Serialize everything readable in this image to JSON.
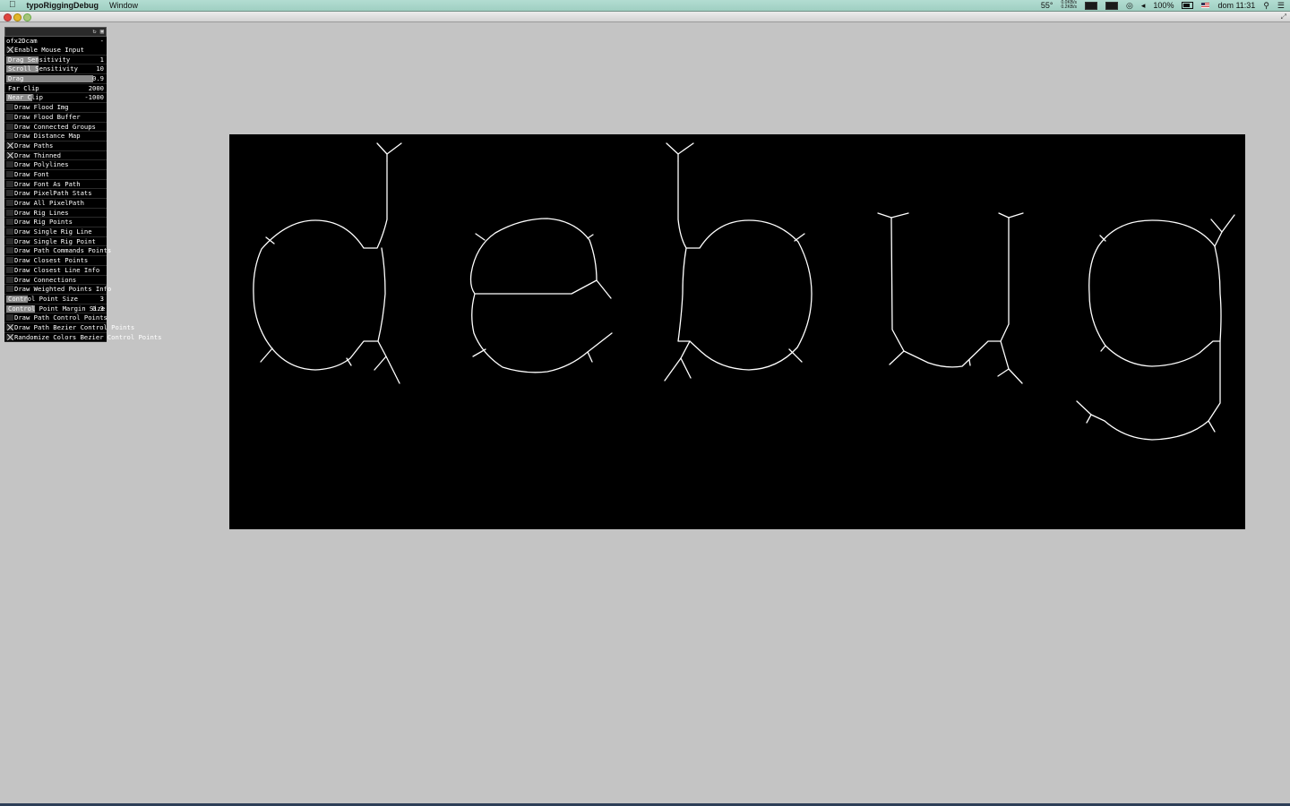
{
  "menubar": {
    "app_name": "typoRiggingDebug",
    "menu_window": "Window",
    "temp": "55°",
    "net_up": "0.0KB/s",
    "net_down": "0.2KB/s",
    "battery": "100%",
    "clock": "dom 11:31"
  },
  "gui": {
    "group_title": "ofx2Dcam",
    "collapse_symbol": "-",
    "rows": [
      {
        "kind": "toggle",
        "label": "Enable Mouse Input",
        "checked": true
      },
      {
        "kind": "slider",
        "label": "Drag Sensitivity",
        "value": "1",
        "fill": 0.33
      },
      {
        "kind": "slider",
        "label": "Scroll Sensitivity",
        "value": "10",
        "fill": 0.33
      },
      {
        "kind": "slider",
        "label": "Drag",
        "value": "0.9",
        "fill": 0.9
      },
      {
        "kind": "slider",
        "label": "Far Clip",
        "value": "2000",
        "fill": 0.0
      },
      {
        "kind": "slider",
        "label": "Near Clip",
        "value": "-1000",
        "fill": 0.27
      },
      {
        "kind": "toggle",
        "label": "Draw Flood Img",
        "checked": false
      },
      {
        "kind": "toggle",
        "label": "Draw Flood Buffer",
        "checked": false
      },
      {
        "kind": "toggle",
        "label": "Draw Connected Groups",
        "checked": false
      },
      {
        "kind": "toggle",
        "label": "Draw Distance Map",
        "checked": false
      },
      {
        "kind": "toggle",
        "label": "Draw Paths",
        "checked": true
      },
      {
        "kind": "toggle",
        "label": "Draw Thinned",
        "checked": true
      },
      {
        "kind": "toggle",
        "label": "Draw Polylines",
        "checked": false
      },
      {
        "kind": "toggle",
        "label": "Draw Font",
        "checked": false
      },
      {
        "kind": "toggle",
        "label": "Draw Font As Path",
        "checked": false
      },
      {
        "kind": "toggle",
        "label": "Draw PixelPath Stats",
        "checked": false
      },
      {
        "kind": "toggle",
        "label": "Draw All PixelPath",
        "checked": false
      },
      {
        "kind": "toggle",
        "label": "Draw Rig Lines",
        "checked": false
      },
      {
        "kind": "toggle",
        "label": "Draw Rig Points",
        "checked": false
      },
      {
        "kind": "toggle",
        "label": "Draw Single Rig Line",
        "checked": false
      },
      {
        "kind": "toggle",
        "label": "Draw Single Rig Point",
        "checked": false
      },
      {
        "kind": "toggle",
        "label": "Draw Path Commands Points",
        "checked": false
      },
      {
        "kind": "toggle",
        "label": "Draw Closest Points",
        "checked": false
      },
      {
        "kind": "toggle",
        "label": "Draw Closest Line Info",
        "checked": false
      },
      {
        "kind": "toggle",
        "label": "Draw Connections",
        "checked": false
      },
      {
        "kind": "toggle",
        "label": "Draw Weighted Points Info",
        "checked": false
      },
      {
        "kind": "slider",
        "label": "Control Point Size",
        "value": "3",
        "fill": 0.22
      },
      {
        "kind": "slider",
        "label": "Control Point Margin Size",
        "value": "0.3",
        "fill": 0.3
      },
      {
        "kind": "toggle",
        "label": "Draw Path Control Points",
        "checked": false
      },
      {
        "kind": "toggle",
        "label": "Draw Path Bezier Control Points",
        "checked": true
      },
      {
        "kind": "toggle",
        "label": "Randomize Colors Bezier Control Points",
        "checked": true
      }
    ]
  },
  "canvas": {
    "word": "debug",
    "stroke_color": "#ffffff",
    "background_color": "#000000"
  },
  "colors": {
    "desktop": "#c4c4c4",
    "menubar": "#a9d7ca"
  }
}
